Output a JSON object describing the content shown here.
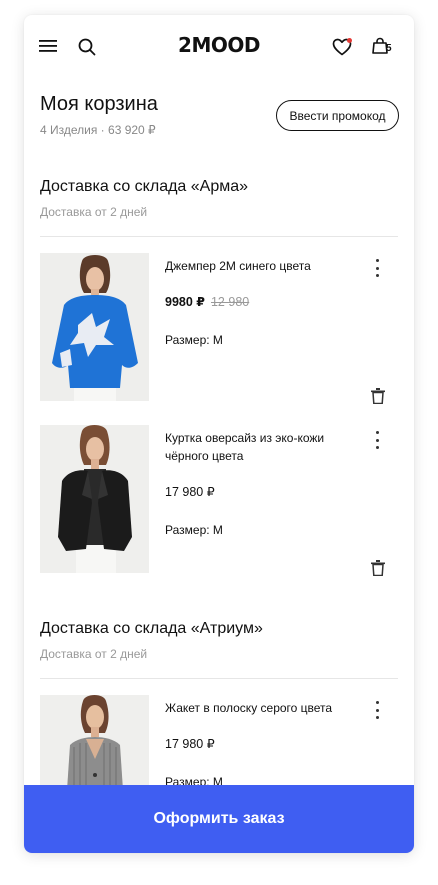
{
  "header": {
    "brand": "2MOOD",
    "cart_count": "5"
  },
  "cart": {
    "title": "Моя корзина",
    "summary": "4 Изделия · 63 920 ₽",
    "promo_label": "Ввести промокод"
  },
  "sections": [
    {
      "title": "Доставка со склада «Арма»",
      "subtitle": "Доставка от 2 дней",
      "items": [
        {
          "name": "Джемпер 2М синего цвета",
          "price": "9980 ₽",
          "old_price": "12 980",
          "size": "Размер: M"
        },
        {
          "name": "Куртка оверсайз из эко-кожи чёрного цвета",
          "price": "17 980 ₽",
          "size": "Размер: M"
        }
      ]
    },
    {
      "title": "Доставка со склада «Атриум»",
      "subtitle": "Доставка от 2 дней",
      "items": [
        {
          "name": "Жакет в полоску серого цвета",
          "price": "17 980 ₽",
          "size": "Размер: M"
        }
      ]
    }
  ],
  "checkout_label": "Оформить заказ",
  "colors": {
    "accent": "#3f5ef2",
    "badge": "#e53935"
  }
}
